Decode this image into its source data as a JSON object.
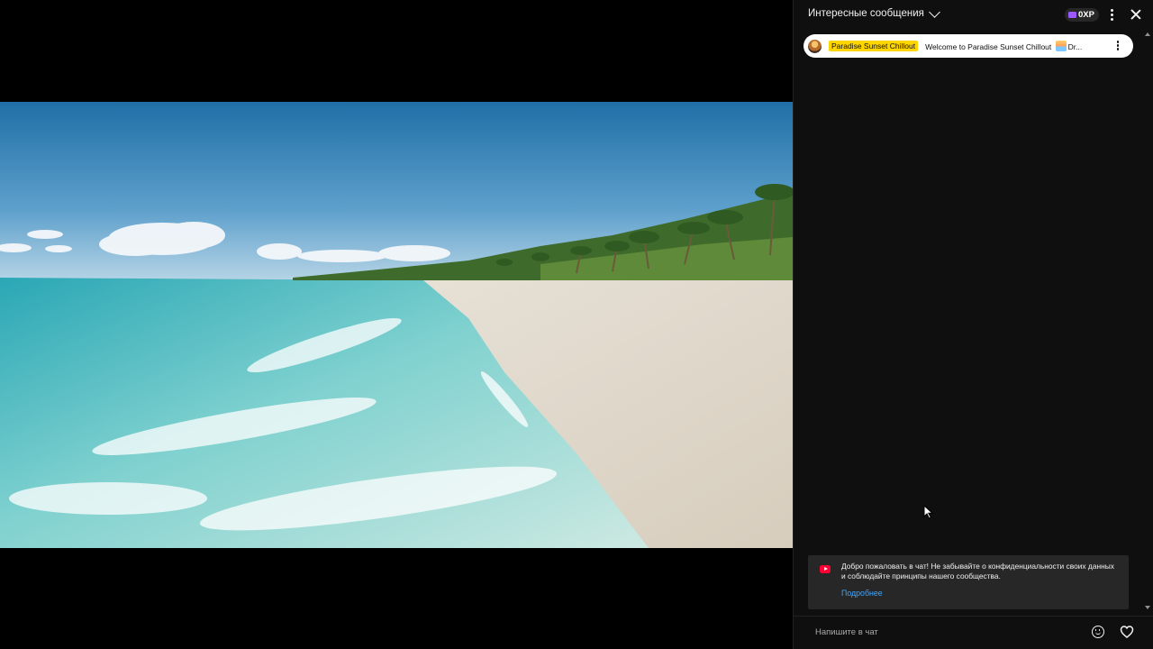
{
  "chat": {
    "title": "Интересные сообщения",
    "xp_label": "0XP",
    "pinned": {
      "author": "Paradise Sunset Chillout",
      "text_before": "Welcome to Paradise Sunset Chillout",
      "text_after": "Dr..."
    },
    "welcome": {
      "text": "Добро пожаловать в чат! Не забывайте о конфиденциальности своих данных и соблюдайте принципы нашего сообщества.",
      "link": "Подробнее"
    },
    "input_placeholder": "Напишите в чат"
  },
  "icons": {
    "title_chevron": "chevron-down-icon",
    "xp_icon": "xp-icon",
    "menu": "more-vert-icon",
    "close": "close-icon",
    "avatar": "channel-avatar",
    "sun_emoji": "sunrise-emoji-icon",
    "pin_menu": "more-vert-icon",
    "youtube": "youtube-logo-icon",
    "emoji": "emoji-icon",
    "heart": "heart-icon",
    "cursor": "mouse-cursor-icon"
  },
  "colors": {
    "chat_bg": "#0f0f0f",
    "author_highlight": "#ffd600",
    "link": "#3ea6ff",
    "welcome_bg": "#272727"
  }
}
